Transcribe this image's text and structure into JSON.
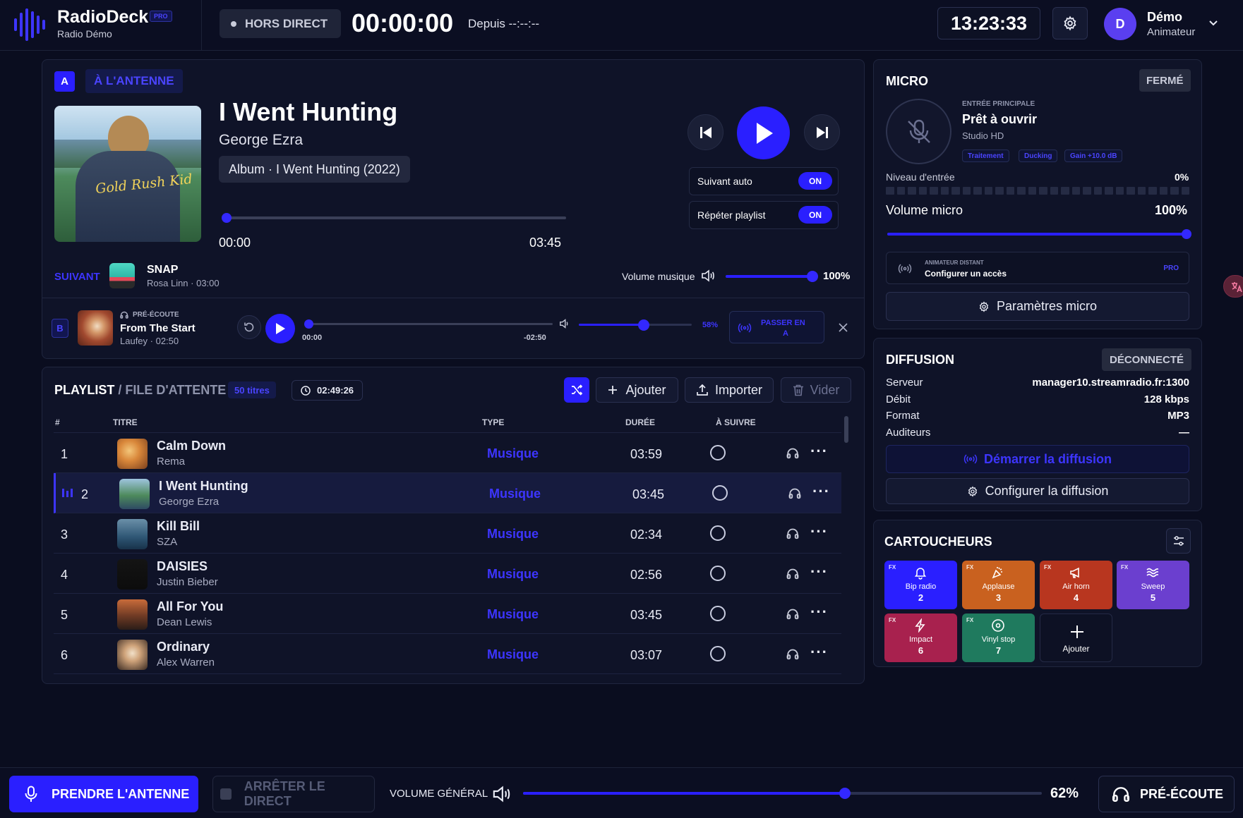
{
  "header": {
    "app_name": "RadioDeck",
    "pro_badge": "PRO",
    "station": "Radio Démo",
    "status": "HORS DIRECT",
    "timer": "00:00:00",
    "since": "Depuis --:--:--",
    "clock": "13:23:33",
    "user_initial": "D",
    "user_name": "Démo",
    "user_role": "Animateur"
  },
  "deck_a": {
    "letter": "A",
    "status": "À L'ANTENNE",
    "title": "I Went Hunting",
    "artist": "George Ezra",
    "album": "Album · I Went Hunting (2022)",
    "album_art_text": "Gold Rush Kid",
    "position": "00:00",
    "duration": "03:45",
    "progress": 0,
    "auto_next_label": "Suivant auto",
    "auto_next_state": "ON",
    "repeat_label": "Répéter playlist",
    "repeat_state": "ON",
    "next_label": "SUIVANT",
    "next_title": "SNAP",
    "next_meta": "Rosa Linn · 03:00",
    "music_volume_label": "Volume musique",
    "music_volume": "100%"
  },
  "deck_b": {
    "letter": "B",
    "label": "PRÉ-ÉCOUTE",
    "title": "From The Start",
    "meta": "Laufey · 02:50",
    "position": "00:00",
    "remaining": "-02:50",
    "volume": "58%",
    "send_label_1": "PASSER EN",
    "send_label_2": "A"
  },
  "playlist": {
    "title": "PLAYLIST",
    "subtitle": "/ FILE D'ATTENTE",
    "count": "50 titres",
    "total": "02:49:26",
    "add": "Ajouter",
    "import": "Importer",
    "clear": "Vider",
    "columns": {
      "num": "#",
      "title": "TITRE",
      "type": "TYPE",
      "duration": "DURÉE",
      "next": "À SUIVRE"
    },
    "rows": [
      {
        "num": "1",
        "title": "Calm Down",
        "artist": "Rema",
        "type": "Musique",
        "duration": "03:59"
      },
      {
        "num": "2",
        "title": "I Went Hunting",
        "artist": "George Ezra",
        "type": "Musique",
        "duration": "03:45"
      },
      {
        "num": "3",
        "title": "Kill Bill",
        "artist": "SZA",
        "type": "Musique",
        "duration": "02:34"
      },
      {
        "num": "4",
        "title": "DAISIES",
        "artist": "Justin Bieber",
        "type": "Musique",
        "duration": "02:56"
      },
      {
        "num": "5",
        "title": "All For You",
        "artist": "Dean Lewis",
        "type": "Musique",
        "duration": "03:45"
      },
      {
        "num": "6",
        "title": "Ordinary",
        "artist": "Alex Warren",
        "type": "Musique",
        "duration": "03:07"
      }
    ]
  },
  "micro": {
    "title": "MICRO",
    "state": "FERMÉ",
    "input_label": "ENTRÉE PRINCIPALE",
    "ready": "Prêt à ouvrir",
    "device": "Studio HD",
    "tags": [
      "Traitement",
      "Ducking",
      "Gain +10.0 dB"
    ],
    "level_label": "Niveau d'entrée",
    "level_value": "0%",
    "volume_label": "Volume micro",
    "volume_value": "100%",
    "remote_label": "ANIMATEUR DISTANT",
    "remote_action": "Configurer un accès",
    "remote_badge": "PRO",
    "settings": "Paramètres micro"
  },
  "diffusion": {
    "title": "DIFFUSION",
    "state": "DÉCONNECTÉ",
    "server_label": "Serveur",
    "server": "manager10.streamradio.fr:1300",
    "bitrate_label": "Débit",
    "bitrate": "128 kbps",
    "format_label": "Format",
    "format": "MP3",
    "listeners_label": "Auditeurs",
    "listeners": "—",
    "start": "Démarrer la diffusion",
    "configure": "Configurer la diffusion"
  },
  "carts": {
    "title": "CARTOUCHEURS",
    "fx": "FX",
    "pads": [
      {
        "name": "Bip radio",
        "num": "2",
        "color": "#2a1fff",
        "icon": "bell-icon"
      },
      {
        "name": "Applause",
        "num": "3",
        "color": "#c9611f",
        "icon": "party-popper-icon"
      },
      {
        "name": "Air horn",
        "num": "4",
        "color": "#b8361f",
        "icon": "megaphone-icon"
      },
      {
        "name": "Sweep",
        "num": "5",
        "color": "#6b3fcf",
        "icon": "waves-icon"
      },
      {
        "name": "Impact",
        "num": "6",
        "color": "#a8214e",
        "icon": "lightning-icon"
      },
      {
        "name": "Vinyl stop",
        "num": "7",
        "color": "#1f7a5e",
        "icon": "disc-icon"
      }
    ],
    "add": "Ajouter"
  },
  "footer": {
    "take_air": "PRENDRE L'ANTENNE",
    "stop_live": "ARRÊTER LE DIRECT",
    "master_label": "VOLUME GÉNÉRAL",
    "master_value": "62%",
    "master_level": 0.62,
    "preview": "PRÉ-ÉCOUTE"
  }
}
